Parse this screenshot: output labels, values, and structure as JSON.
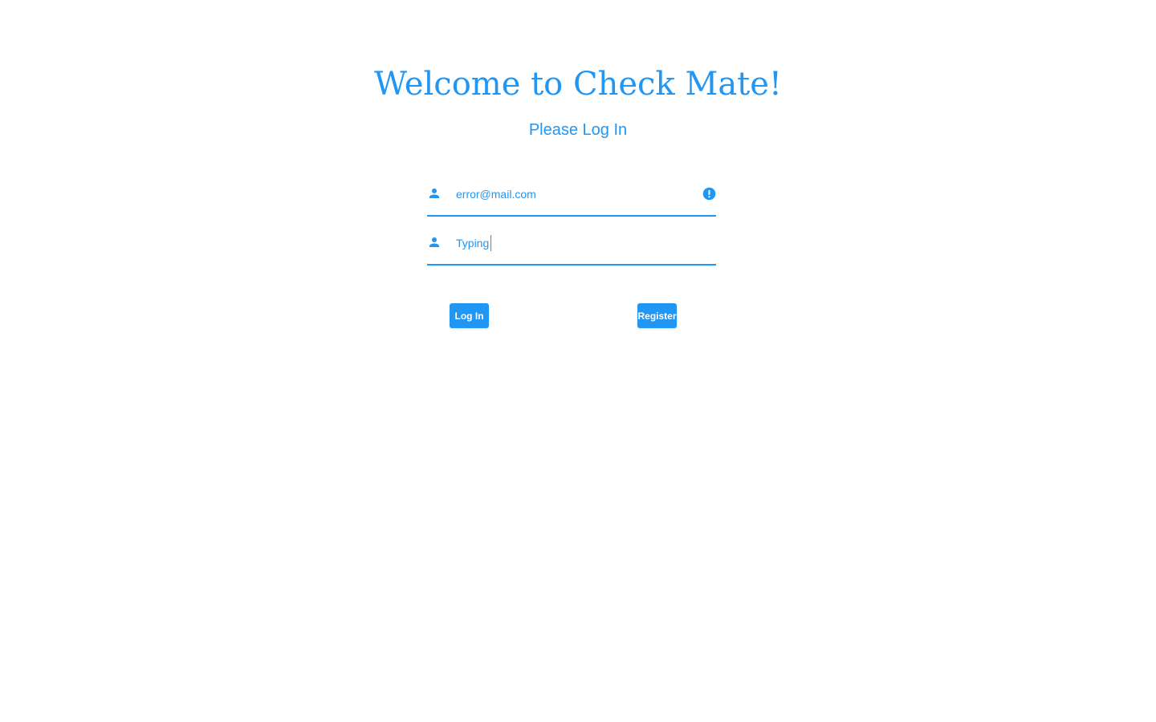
{
  "header": {
    "title": "Welcome to Check Mate!",
    "subtitle": "Please Log In"
  },
  "form": {
    "email": {
      "value": "error@mail.com",
      "icon": "person-icon",
      "state_icon": "error-alert-icon"
    },
    "password": {
      "value": "Typing",
      "icon": "person-icon"
    }
  },
  "actions": {
    "login_label": "Log In",
    "register_label": "Register"
  },
  "colors": {
    "accent": "#2196f3",
    "background": "#ffffff",
    "button_text": "#ffffff"
  }
}
